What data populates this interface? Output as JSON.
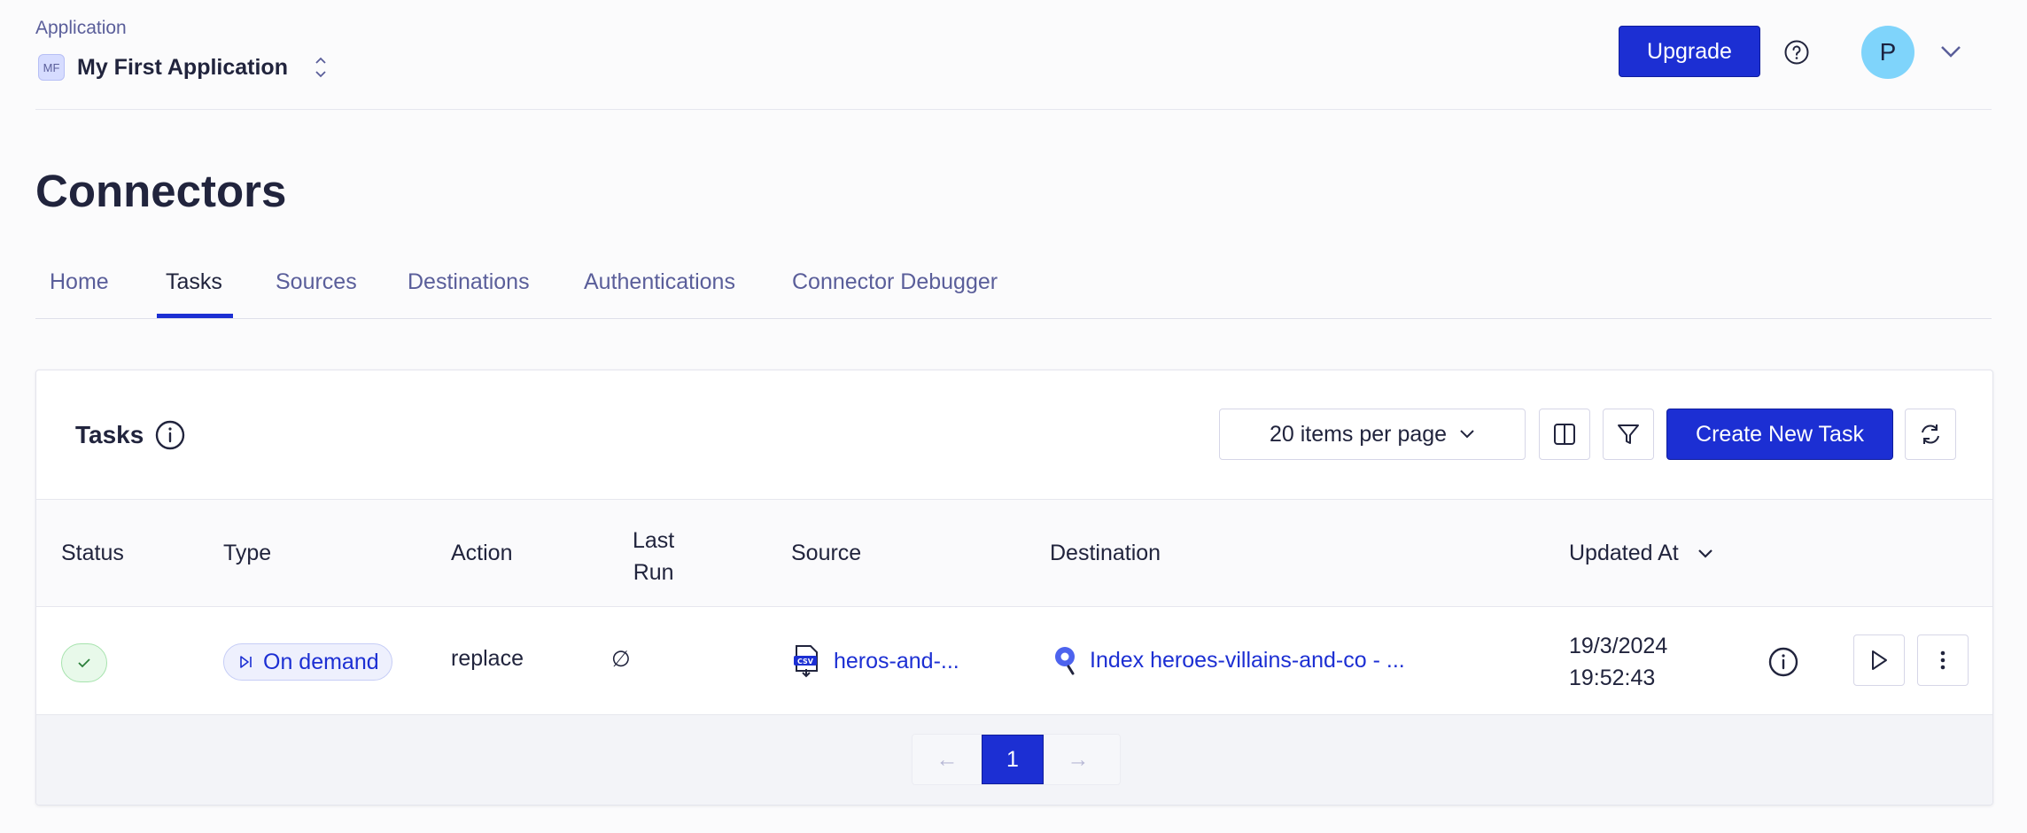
{
  "header": {
    "section_label": "Application",
    "app_initials": "MF",
    "app_name": "My First Application",
    "upgrade_label": "Upgrade",
    "avatar_initial": "P"
  },
  "page": {
    "title": "Connectors"
  },
  "tabs": [
    {
      "label": "Home",
      "active": false
    },
    {
      "label": "Tasks",
      "active": true
    },
    {
      "label": "Sources",
      "active": false
    },
    {
      "label": "Destinations",
      "active": false
    },
    {
      "label": "Authentications",
      "active": false
    },
    {
      "label": "Connector Debugger",
      "active": false
    }
  ],
  "tasks_card": {
    "title": "Tasks",
    "per_page_label": "20 items per page",
    "create_label": "Create New Task",
    "columns": {
      "status": "Status",
      "type": "Type",
      "action": "Action",
      "last_run_line1": "Last",
      "last_run_line2": "Run",
      "source": "Source",
      "destination": "Destination",
      "updated_at": "Updated At"
    },
    "rows": [
      {
        "status": "success",
        "type": "On demand",
        "action": "replace",
        "last_run": "∅",
        "source": "heros-and-...",
        "destination": "Index heroes-villains-and-co - ...",
        "updated_date": "19/3/2024",
        "updated_time": "19:52:43"
      }
    ],
    "pagination": {
      "prev": "←",
      "current_page": "1",
      "next": "→"
    }
  },
  "colors": {
    "primary": "#1c2fd3",
    "text": "#21243d",
    "muted": "#5a5e9a",
    "avatar": "#7fd4fb",
    "success_bg": "#e8f9ea"
  }
}
